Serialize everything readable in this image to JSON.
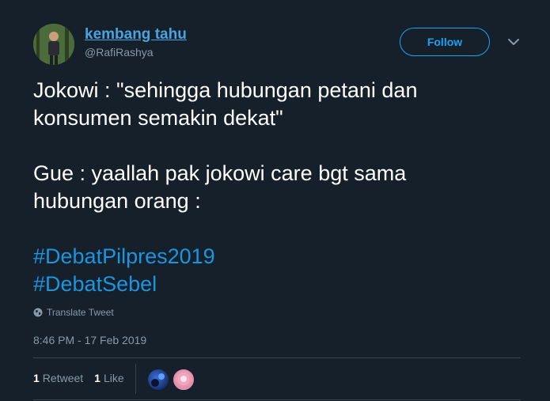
{
  "tweet": {
    "display_name": "kembang tahu",
    "handle": "@RafiRashya",
    "follow_label": "Follow",
    "text_lines": [
      "Jokowi : \"sehingga hubungan petani dan",
      "konsumen semakin dekat\"",
      "Gue : yaallah pak jokowi care bgt sama",
      "hubungan orang :"
    ],
    "hashtags": [
      "#DebatPilpres2019",
      "#DebatSebel"
    ],
    "translate_label": "Translate Tweet",
    "timestamp": "8:46 PM - 17 Feb 2019",
    "retweet_count": "1",
    "retweet_label": "Retweet",
    "like_count": "1",
    "like_label": "Like"
  },
  "icons": {
    "caret": "chevron-down-icon",
    "translate": "globe-icon"
  },
  "colors": {
    "background": "#15202b",
    "accent": "#1da1f2",
    "hashtag": "#1b95e0",
    "muted_text": "#8899a6",
    "divider": "#38444d"
  }
}
